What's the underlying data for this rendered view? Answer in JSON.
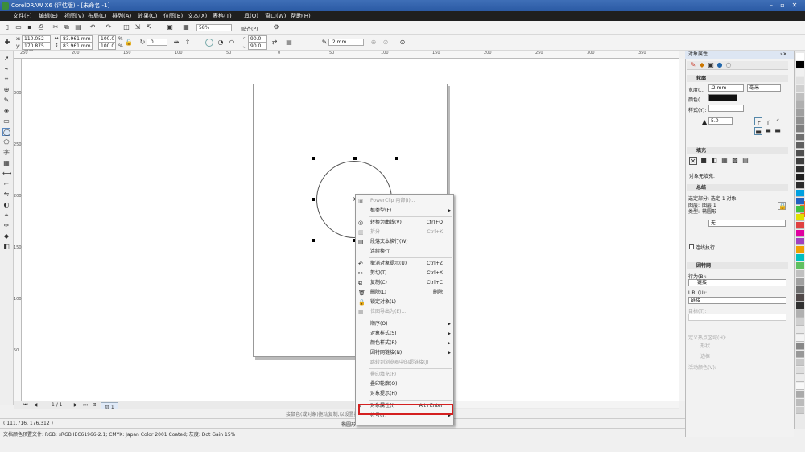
{
  "window": {
    "title": "CorelDRAW X6 (评估版) - [未命名 -1]"
  },
  "menubar": [
    "文件(F)",
    "编辑(E)",
    "视图(V)",
    "布局(L)",
    "排列(A)",
    "效果(C)",
    "位图(B)",
    "文本(X)",
    "表格(T)",
    "工具(O)",
    "窗口(W)",
    "帮助(H)"
  ],
  "toolbar1": {
    "zoom": "58%",
    "snap": "贴齐(P)"
  },
  "propbar": {
    "x_label": "x:",
    "x_value": "110.052 mm",
    "y_label": "y:",
    "y_value": "170.875 mm",
    "w_value": "83.961 mm",
    "h_value": "83.961 mm",
    "scale_x": "100.0",
    "scale_y": "100.0",
    "pct": "%",
    "rotate": ".0",
    "angle1": "90.0",
    "angle2": "90.0",
    "outline_width": ".2 mm"
  },
  "ruler": {
    "h_ticks": [
      "250",
      "200",
      "150",
      "100",
      "50",
      "0",
      "50",
      "100",
      "150",
      "200",
      "250",
      "300",
      "350"
    ],
    "v_ticks": [
      "300",
      "250",
      "200",
      "150",
      "100",
      "50"
    ],
    "unit": "毫米"
  },
  "toolbox_icons": [
    "pick-icon",
    "shape-icon",
    "crop-icon",
    "zoom-icon",
    "freehand-icon",
    "smart-fill-icon",
    "rectangle-icon",
    "ellipse-icon",
    "polygon-icon",
    "text-icon",
    "table-icon",
    "dimension-icon",
    "connector-icon",
    "blend-icon",
    "transparency-icon",
    "eyedropper-icon",
    "outline-icon",
    "fill-icon",
    "interactive-fill-icon"
  ],
  "context_menu": {
    "items": [
      {
        "label": "PowerClip 内部(I)...",
        "shortcut": "",
        "arrow": false,
        "disabled": true,
        "sep_after": false
      },
      {
        "label": "框类型(F)",
        "shortcut": "",
        "arrow": true,
        "disabled": false,
        "sep_after": true
      },
      {
        "label": "转换为曲线(V)",
        "shortcut": "Ctrl+Q",
        "arrow": false,
        "disabled": false,
        "sep_after": false
      },
      {
        "label": "拆分",
        "shortcut": "Ctrl+K",
        "arrow": false,
        "disabled": true,
        "sep_after": false
      },
      {
        "label": "段落文本换行(W)",
        "shortcut": "",
        "arrow": false,
        "disabled": false,
        "sep_after": false
      },
      {
        "label": "连续换行",
        "shortcut": "",
        "arrow": false,
        "disabled": false,
        "sep_after": true
      },
      {
        "label": "撤消对象提示(U)",
        "shortcut": "Ctrl+Z",
        "arrow": false,
        "disabled": false,
        "sep_after": false
      },
      {
        "label": "剪切(T)",
        "shortcut": "Ctrl+X",
        "arrow": false,
        "disabled": false,
        "sep_after": false
      },
      {
        "label": "复制(C)",
        "shortcut": "Ctrl+C",
        "arrow": false,
        "disabled": false,
        "sep_after": false
      },
      {
        "label": "删除(L)",
        "shortcut": "删除",
        "arrow": false,
        "disabled": false,
        "sep_after": false
      },
      {
        "label": "锁定对象(L)",
        "shortcut": "",
        "arrow": false,
        "disabled": false,
        "sep_after": false
      },
      {
        "label": "位图导出为(E)...",
        "shortcut": "",
        "arrow": false,
        "disabled": true,
        "sep_after": true
      },
      {
        "label": "顺序(O)",
        "shortcut": "",
        "arrow": true,
        "disabled": false,
        "sep_after": false
      },
      {
        "label": "对象样式(S)",
        "shortcut": "",
        "arrow": true,
        "disabled": false,
        "sep_after": false
      },
      {
        "label": "颜色样式(R)",
        "shortcut": "",
        "arrow": true,
        "disabled": false,
        "sep_after": false
      },
      {
        "label": "因特网链接(N)",
        "shortcut": "",
        "arrow": true,
        "disabled": false,
        "sep_after": false
      },
      {
        "label": "跳转到浏览器中的超链接(J)",
        "shortcut": "",
        "arrow": false,
        "disabled": true,
        "sep_after": true
      },
      {
        "label": "叠印填充(F)",
        "shortcut": "",
        "arrow": false,
        "disabled": true,
        "sep_after": false
      },
      {
        "label": "叠印轮廓(O)",
        "shortcut": "",
        "arrow": false,
        "disabled": false,
        "sep_after": false
      },
      {
        "label": "对象提示(H)",
        "shortcut": "",
        "arrow": false,
        "disabled": false,
        "sep_after": true
      },
      {
        "label": "对象属性(I)",
        "shortcut": "Alt+Enter",
        "arrow": false,
        "disabled": false,
        "sep_after": false,
        "checked": true
      },
      {
        "label": "符号(Y)",
        "shortcut": "",
        "arrow": true,
        "disabled": false,
        "sep_after": false
      }
    ]
  },
  "pagenav": {
    "page": "1 / 1",
    "tab": "页 1"
  },
  "status": {
    "hint": "接鼠色(或对象)拖动复制,以设置按住 Shift 选择颜色以...",
    "coords": "( 111.716, 176.312 )",
    "object": "椭圆形",
    "docinfo": "文档颜色预置文件: RGB: sRGB IEC61966-2.1; CMYK: Japan Color 2001 Coated; 灰度: Dot Gain 15%"
  },
  "docker": {
    "title": "对象属性",
    "outline_section": "轮廓",
    "width_label": "宽度(...",
    "width_value": ".2 mm",
    "width_unit": "毫米",
    "color_label": "颜色(...",
    "style_label": "样式(Y):",
    "miter_value": "5.0",
    "fill_section": "填充",
    "fill_status": "对象无填充.",
    "summary_section": "总结",
    "selection": "选定部分: 选定 1 对象",
    "layer": "图层:",
    "layer_value": "图层 1",
    "type": "类型:",
    "type_value": "椭圆形",
    "none_value": "无",
    "wrap_label": "连线执行",
    "internet_section": "因特网",
    "behavior_label": "行为(B):",
    "behavior_value": "链接",
    "url_label": "URL(U):",
    "url_value": "链接",
    "target_label": "目标(T):",
    "define_label": "定义热点区域(H):",
    "shape_opt": "形状",
    "border_opt": "边框",
    "highlight_label": "活动颜色(V):"
  },
  "palette_colors": [
    "#ffffff",
    "#000000",
    "#f0f0f0",
    "#e0e0e0",
    "#cfcfcf",
    "#bfbfbf",
    "#afafaf",
    "#9f9f9f",
    "#8f8f8f",
    "#7f7f7f",
    "#6f6f6f",
    "#5f5f5f",
    "#4f4f4f",
    "#3f3f3f",
    "#2f2f2f",
    "#1f1f1f",
    "#2b2b2b",
    "#00a0e0",
    "#2060c0",
    "#40c040",
    "#e0e000",
    "#e04040",
    "#e000a0",
    "#a040c0",
    "#f0a000",
    "#00c0c0",
    "#60c060",
    "#c0c0c0",
    "#a0a0a0",
    "#707070",
    "#504848",
    "#303030",
    "#b0b0b0",
    "#d0d0d0",
    "#e8e8e8",
    "#f4f4f4",
    "#888888",
    "#989898",
    "#c8c8c8",
    "#dedede",
    "#ececec",
    "#f8f8f8",
    "#aaaaaa",
    "#bcbcbc",
    "#cccccc"
  ],
  "accent": "#d42020"
}
